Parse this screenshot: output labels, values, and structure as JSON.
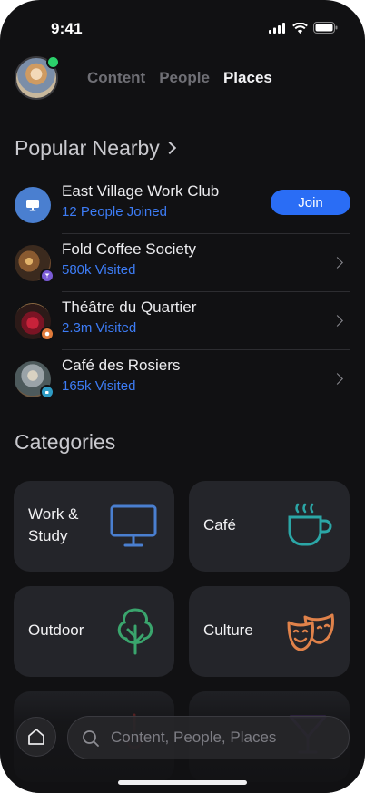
{
  "status_bar": {
    "time": "9:41"
  },
  "header": {
    "tabs": [
      {
        "label": "Content",
        "active": false
      },
      {
        "label": "People",
        "active": false
      },
      {
        "label": "Places",
        "active": true
      }
    ]
  },
  "popular": {
    "title": "Popular Nearby",
    "items": [
      {
        "name": "East Village Work Club",
        "sub": "12 People Joined",
        "action": "Join",
        "icon": "monitor-icon"
      },
      {
        "name": "Fold Coffee Society",
        "sub": "580k Visited",
        "badge_color": "#7a5bd6"
      },
      {
        "name": "Théâtre du Quartier",
        "sub": "2.3m Visited",
        "badge_color": "#e07a3a"
      },
      {
        "name": "Café des Rosiers",
        "sub": "165k Visited",
        "badge_color": "#2e9bc4"
      }
    ]
  },
  "categories": {
    "title": "Categories",
    "items": [
      {
        "line1": "Work &",
        "line2": "Study",
        "icon": "monitor-icon",
        "color": "#4a7fd0"
      },
      {
        "line1": "Café",
        "line2": "",
        "icon": "coffee-cup-icon",
        "color": "#2ba6a6"
      },
      {
        "line1": "Outdoor",
        "line2": "",
        "icon": "tree-icon",
        "color": "#3aa56d"
      },
      {
        "line1": "Culture",
        "line2": "",
        "icon": "theater-masks-icon",
        "color": "#e0824a"
      }
    ]
  },
  "search": {
    "placeholder": "Content, People, Places"
  },
  "colors": {
    "accent": "#2a6df5",
    "link": "#3d7cf5",
    "online": "#2bd16b"
  }
}
